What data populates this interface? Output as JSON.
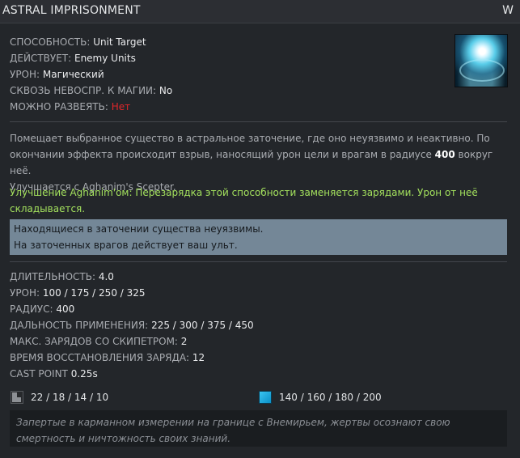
{
  "header": {
    "title": "ASTRAL IMPRISONMENT",
    "hotkey": "W"
  },
  "icon": {
    "name": "astral-imprisonment-icon"
  },
  "stats_top": [
    {
      "label": "СПОСОБНОСТЬ:",
      "value": "Unit Target"
    },
    {
      "label": "ДЕЙСТВУЕТ:",
      "value": "Enemy Units"
    },
    {
      "label": "УРОН:",
      "value": "Магический"
    },
    {
      "label": "СКВОЗЬ НЕВОСПР. К МАГИИ:",
      "value": "No"
    },
    {
      "label": "МОЖНО РАЗВЕЯТЬ:",
      "value": "Нет",
      "value_color": "#e0262a"
    }
  ],
  "description": {
    "part1": "Помещает выбранное существо в астральное заточение, где оно неуязвимо и неактивно. По окончании эффекта происходит взрыв, наносящий урон цели и врагам в радиусе ",
    "bold_value": "400",
    "part2": " вокруг неё.",
    "scepter_line": "Улучшается с Aghanim's Scepter."
  },
  "aghanim": {
    "text": "Улучшение Aghanim'ом: Перезарядка этой способности заменяется зарядами. Урон от неё складывается."
  },
  "notes": [
    "Находящиеся в заточении существа неуязвимы.",
    "На заточенных врагов действует ваш ульт."
  ],
  "stats_bottom": [
    {
      "label": "ДЛИТЕЛЬНОСТЬ:",
      "value": "4.0"
    },
    {
      "label": "УРОН:",
      "value": "100 / 175 / 250 / 325"
    },
    {
      "label": "РАДИУС:",
      "value": "400"
    },
    {
      "label": "ДАЛЬНОСТЬ ПРИМЕНЕНИЯ:",
      "value": "225 / 300 / 375 / 450"
    },
    {
      "label": "МАКС. ЗАРЯДОВ СО СКИПЕТРОМ:",
      "value": "2"
    },
    {
      "label": "ВРЕМЯ ВОССТАНОВЛЕНИЯ ЗАРЯДА:",
      "value": "12"
    },
    {
      "label": "CAST POINT",
      "value": "0.25s"
    }
  ],
  "costs": {
    "cooldown": {
      "icon": "cooldown-icon",
      "value": "22 / 18 / 14 / 10"
    },
    "mana": {
      "icon": "mana-icon",
      "value": "140 / 160 / 180 / 200",
      "color": "#1aa7dc"
    }
  },
  "lore": "Запертые в карманном измерении на границе с Внемирьем, жертвы осознают свою смертность и ничтожность своих знаний."
}
